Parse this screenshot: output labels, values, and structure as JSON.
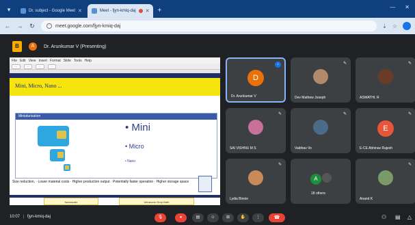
{
  "browser": {
    "tabs": [
      {
        "label": "Dr. subject - Google Meet",
        "active": false
      },
      {
        "label": "Meet - fjyn-kmiq-daj",
        "active": true
      }
    ],
    "url": "meet.google.com/fjyn-kmiq-daj"
  },
  "meet": {
    "presenter_initial": "A",
    "presenting_text": "Dr. Arunkumar V (Presenting)",
    "meeting_code": "fjyn-kmiq-daj",
    "time": "10:07"
  },
  "slide": {
    "title": "Mini, Micro, Nano ...",
    "section_header": "Miniaturisation",
    "bullets": [
      "• Mini",
      "• Micro",
      "• Nano"
    ],
    "body_text": "Size reduction, · Lower material costs · Higher production output · Potentially faster operation · Higher storage space",
    "thumb_left": "Nanoscale",
    "thumb_right": "Ultrasonic Drop Bath"
  },
  "participants": [
    {
      "name": "Dr. Arunkumar V",
      "initial": "D",
      "color": "#e8710a",
      "kind": "initial",
      "state": "speaking"
    },
    {
      "name": "Dev Mathew Joseph",
      "kind": "photo",
      "color": "#b08a6a",
      "state": "muted"
    },
    {
      "name": "ASWATHI. R",
      "kind": "photo",
      "color": "#6b3a28",
      "state": "muted"
    },
    {
      "name": "SAI VISHNU M S",
      "kind": "photo",
      "color": "#c86f9a",
      "state": "muted"
    },
    {
      "name": "Vaibhav Vo",
      "kind": "photo",
      "color": "#4a6b8a",
      "state": "muted"
    },
    {
      "name": "E-CE Abhinav Rajesh",
      "initial": "E",
      "color": "#e8563a",
      "kind": "initial",
      "state": "muted"
    },
    {
      "name": "Lydia Binnie",
      "kind": "photo",
      "color": "#c98a5a",
      "state": "muted"
    },
    {
      "name": "18 others",
      "kind": "group",
      "color": "#1e8e3e",
      "initial": "A",
      "state": "none"
    },
    {
      "name": "Anand K",
      "kind": "photo",
      "color": "#7b9a6a",
      "state": "muted"
    }
  ]
}
